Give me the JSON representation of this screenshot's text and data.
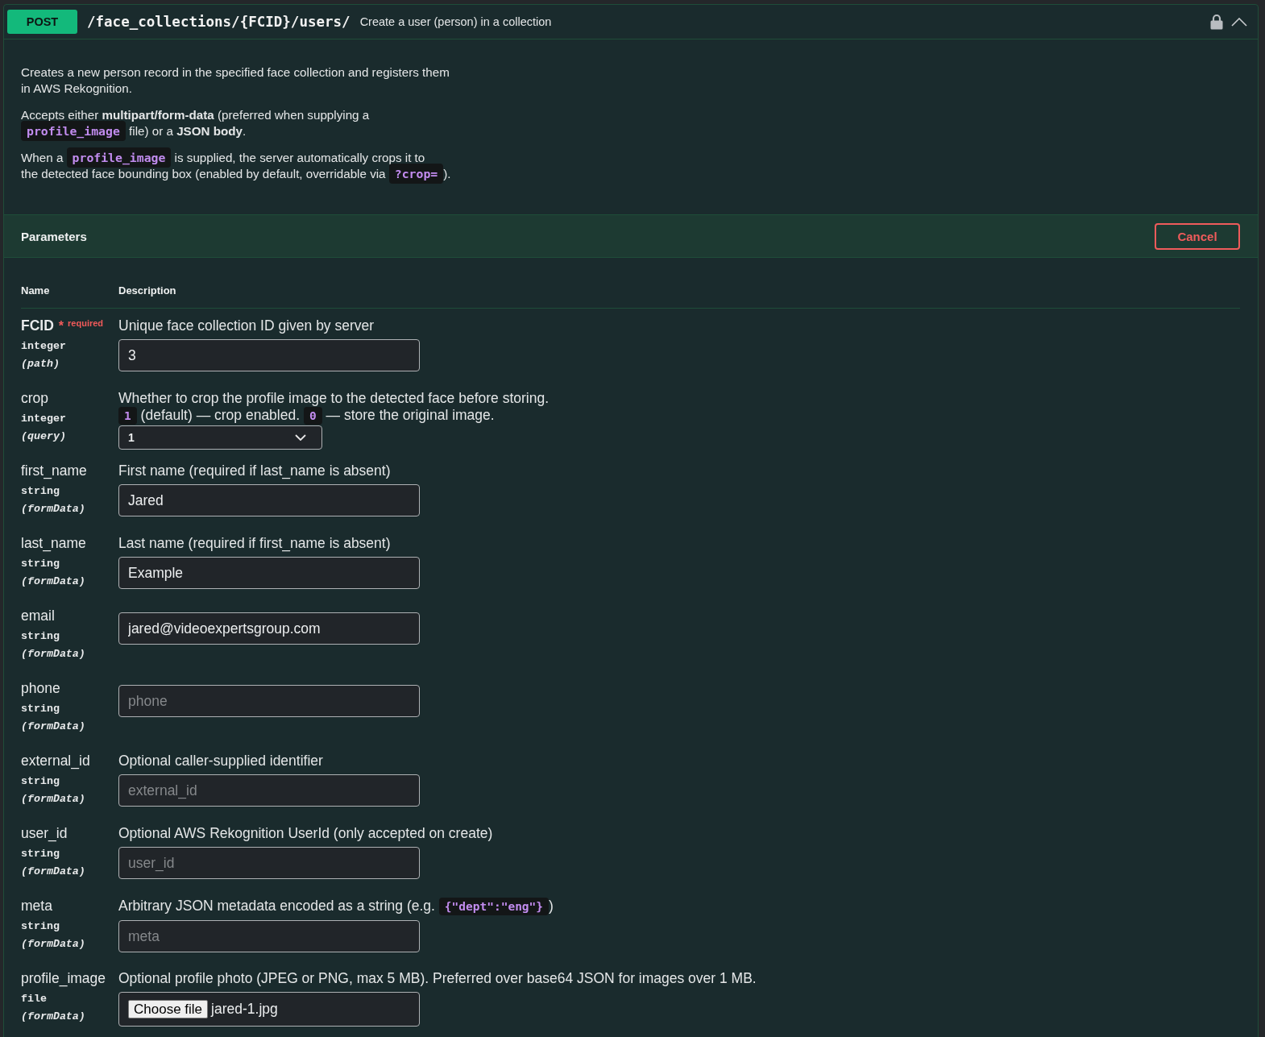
{
  "endpoint": {
    "method": "POST",
    "path": "/face_collections/{FCID}/users/",
    "summary": "Create a user (person) in a collection",
    "locked": true,
    "expanded": true
  },
  "description": [
    [
      [
        {
          "kind": "text",
          "text": "Creates a new person record in the specified face collection and registers them"
        }
      ],
      [
        {
          "kind": "text",
          "text": "in AWS Rekognition."
        }
      ]
    ],
    [
      [
        {
          "kind": "text",
          "text": "Accepts either **multipart/form-data** (preferred when supplying a"
        }
      ],
      [
        {
          "kind": "code",
          "text": "profile_image"
        },
        {
          "kind": "text",
          "text": " file) or a **JSON body**."
        }
      ]
    ],
    [
      [
        {
          "kind": "text",
          "text": "When a "
        },
        {
          "kind": "code",
          "text": "profile_image"
        },
        {
          "kind": "text",
          "text": " is supplied, the server automatically crops it to"
        }
      ],
      [
        {
          "kind": "text",
          "text": "the detected face bounding box (enabled by default, overridable via "
        },
        {
          "kind": "code",
          "text": "?crop="
        },
        {
          "kind": "text",
          "text": ")."
        }
      ]
    ]
  ],
  "parameters": {
    "title": "Parameters",
    "cancel_label": "Cancel",
    "columns": [
      "Name",
      "Description"
    ],
    "items": [
      {
        "name": "FCID",
        "required": true,
        "required_mark": "*",
        "required_label": "required",
        "type": "integer",
        "location": "(path)",
        "description": [
          [
            {
              "kind": "text",
              "text": "Unique face collection ID given by server"
            }
          ]
        ],
        "kind": "text",
        "value": "3"
      },
      {
        "name": "crop",
        "required": false,
        "type": "integer",
        "location": "(query)",
        "description": [
          [
            {
              "kind": "text",
              "text": "Whether to crop the profile image to the detected face before storing."
            }
          ],
          [
            {
              "kind": "code",
              "text": "1"
            },
            {
              "kind": "text",
              "text": " (default) — crop enabled. "
            },
            {
              "kind": "code",
              "text": "0"
            },
            {
              "kind": "text",
              "text": " — store the original image."
            }
          ]
        ],
        "kind": "select",
        "value": "1"
      },
      {
        "name": "first_name",
        "required": false,
        "type": "string",
        "location": "(formData)",
        "description": [
          [
            {
              "kind": "text",
              "text": "First name (required if last_name is absent)"
            }
          ]
        ],
        "kind": "text",
        "value": "Jared"
      },
      {
        "name": "last_name",
        "required": false,
        "type": "string",
        "location": "(formData)",
        "description": [
          [
            {
              "kind": "text",
              "text": "Last name (required if first_name is absent)"
            }
          ]
        ],
        "kind": "text",
        "value": "Example"
      },
      {
        "name": "email",
        "required": false,
        "type": "string",
        "location": "(formData)",
        "kind": "text",
        "value": "jared@videoexpertsgroup.com"
      },
      {
        "name": "phone",
        "required": false,
        "type": "string",
        "location": "(formData)",
        "kind": "text",
        "placeholder": "phone"
      },
      {
        "name": "external_id",
        "required": false,
        "type": "string",
        "location": "(formData)",
        "description": [
          [
            {
              "kind": "text",
              "text": "Optional caller-supplied identifier"
            }
          ]
        ],
        "kind": "text",
        "placeholder": "external_id"
      },
      {
        "name": "user_id",
        "required": false,
        "type": "string",
        "location": "(formData)",
        "description": [
          [
            {
              "kind": "text",
              "text": "Optional AWS Rekognition UserId (only accepted on create)"
            }
          ]
        ],
        "kind": "text",
        "placeholder": "user_id"
      },
      {
        "name": "meta",
        "required": false,
        "type": "string",
        "location": "(formData)",
        "description": [
          [
            {
              "kind": "text",
              "text": "Arbitrary JSON metadata encoded as a string (e.g. "
            },
            {
              "kind": "code",
              "text": "{\"dept\":\"eng\"}"
            },
            {
              "kind": "text",
              "text": ")"
            }
          ]
        ],
        "kind": "text",
        "placeholder": "meta"
      },
      {
        "name": "profile_image",
        "required": false,
        "type": "file",
        "location": "(formData)",
        "description": [
          [
            {
              "kind": "text",
              "text": "Optional profile photo (JPEG or PNG, max 5 MB). Preferred over base64 JSON for images over 1 MB."
            }
          ]
        ],
        "kind": "file",
        "button_label": "Choose file",
        "value": "jared-1.jpg"
      }
    ]
  }
}
